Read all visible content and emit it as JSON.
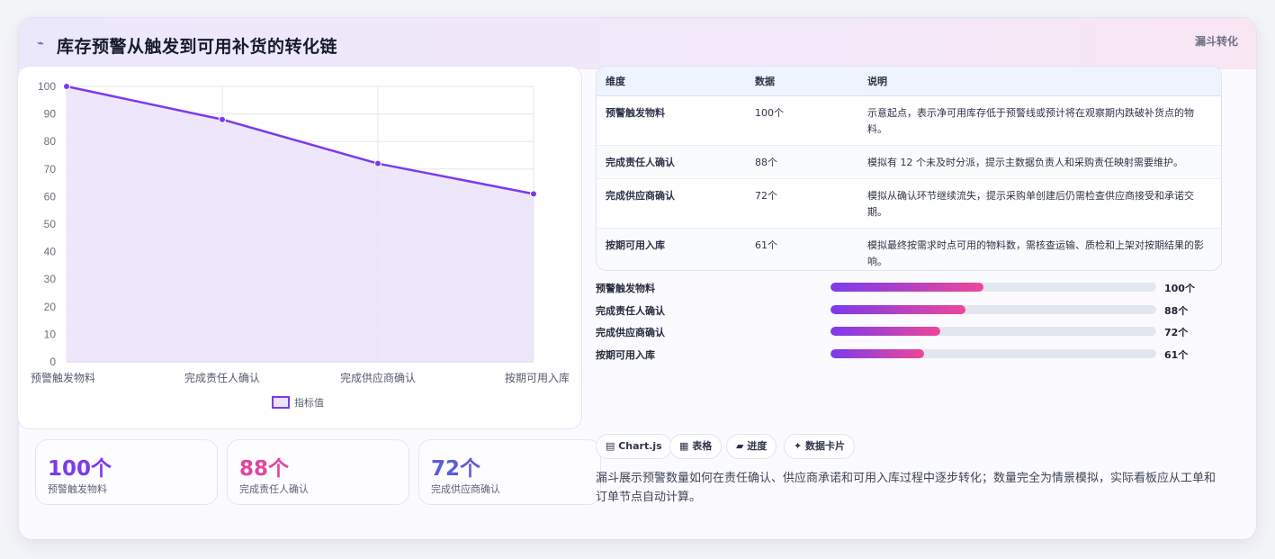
{
  "header": {
    "icon": "lightning-icon",
    "title": "库存预警从触发到可用补货的转化链",
    "tag": "漏斗转化"
  },
  "chart_data": {
    "type": "area",
    "categories": [
      "预警触发物料",
      "完成责任人确认",
      "完成供应商确认",
      "按期可用入库"
    ],
    "series": [
      {
        "name": "指标值",
        "values": [
          100,
          88,
          72,
          61
        ]
      }
    ],
    "ylim": [
      0,
      100
    ],
    "yticks": [
      100,
      90,
      80,
      70,
      60,
      50,
      40,
      30,
      20,
      10,
      0
    ],
    "grid": true,
    "legend": "bottom",
    "line_color": "#7c3aed",
    "fill_color": "#ebe3fa"
  },
  "kpis": [
    {
      "value": "100个",
      "label": "预警触发物料",
      "color": "#7c3aed"
    },
    {
      "value": "88个",
      "label": "完成责任人确认",
      "color": "#e0479e"
    },
    {
      "value": "72个",
      "label": "完成供应商确认",
      "color": "#5b5ed9"
    }
  ],
  "table": {
    "headers": [
      "维度",
      "数据",
      "说明"
    ],
    "rows": [
      {
        "dim": "预警触发物料",
        "val": "100个",
        "desc": "示意起点，表示净可用库存低于预警线或预计将在观察期内跌破补货点的物料。"
      },
      {
        "dim": "完成责任人确认",
        "val": "88个",
        "desc": "模拟有 12 个未及时分派，提示主数据负责人和采购责任映射需要维护。"
      },
      {
        "dim": "完成供应商确认",
        "val": "72个",
        "desc": "模拟从确认环节继续流失，提示采购单创建后仍需检查供应商接受和承诺交期。"
      },
      {
        "dim": "按期可用入库",
        "val": "61个",
        "desc": "模拟最终按需求时点可用的物料数，需核查运输、质检和上架对按期结果的影响。"
      }
    ]
  },
  "progress": [
    {
      "label": "预警触发物料",
      "value": "100个",
      "fraction": 0.47
    },
    {
      "label": "完成责任人确认",
      "value": "88个",
      "fraction": 0.413
    },
    {
      "label": "完成供应商确认",
      "value": "72个",
      "fraction": 0.338
    },
    {
      "label": "按期可用入库",
      "value": "61个",
      "fraction": 0.287
    }
  ],
  "chips": [
    {
      "icon": "chart-icon",
      "label": "▤ Chart.js"
    },
    {
      "icon": "table-icon",
      "label": "▦ 表格"
    },
    {
      "icon": "progress-icon",
      "label": "▰ 进度"
    },
    {
      "icon": "sparkle-icon",
      "label": "✦ 数据卡片"
    }
  ],
  "footnote": "漏斗展示预警数量如何在责任确认、供应商承诺和可用入库过程中逐步转化；数量完全为情景模拟，实际看板应从工单和订单节点自动计算。"
}
